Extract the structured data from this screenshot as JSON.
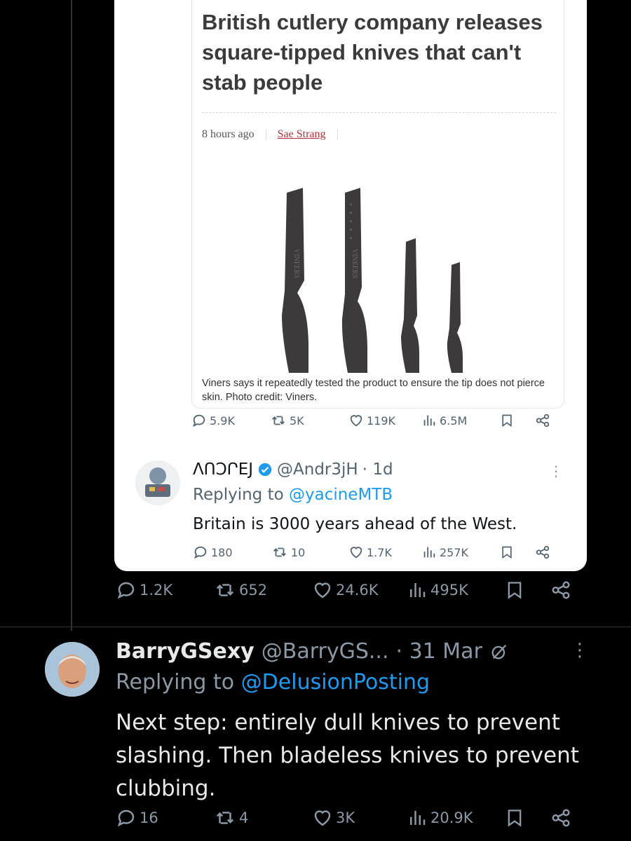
{
  "quoted_article": {
    "headline": "British cutlery company releases square-tipped knives that can't stab people",
    "time": "8 hours ago",
    "author": "Sae Strang",
    "product_brand": "VINEERS",
    "caption": "Viners says it repeatedly tested the product to ensure the tip does not pierce skin. Photo credit: Viners."
  },
  "quoted_tweet_metrics": {
    "replies": "5.9K",
    "reposts": "5K",
    "likes": "119K",
    "views": "6.5M"
  },
  "reply_tweet": {
    "display_name": "ΛՈϽՐΕЈ",
    "handle": "@Andr3jH",
    "time": "· 1d",
    "replying_prefix": "Replying to ",
    "replying_to": "@yacineMTB",
    "text": "Britain is 3000 years ahead of the West.",
    "metrics": {
      "replies": "180",
      "reposts": "10",
      "likes": "1.7K",
      "views": "257K"
    }
  },
  "main_tweet_metrics": {
    "replies": "1.2K",
    "reposts": "652",
    "likes": "24.6K",
    "views": "495K"
  },
  "bottom_tweet": {
    "display_name": "BarryGSexy",
    "handle": "@BarryGS...",
    "time": "· 31 Mar",
    "replying_prefix": "Replying to ",
    "replying_to": "@DelusionPosting",
    "text": "Next step: entirely dull knives to prevent slashing. Then bladeless knives to prevent clubbing.",
    "metrics": {
      "replies": "16",
      "reposts": "4",
      "likes": "3K",
      "views": "20.9K"
    }
  },
  "colors": {
    "accent": "#1d9bf0",
    "muted": "#8b98a5",
    "background": "#000000"
  },
  "icons": [
    "reply-icon",
    "repost-icon",
    "like-icon",
    "views-icon",
    "bookmark-icon",
    "share-icon",
    "verified-icon",
    "more-icon"
  ]
}
